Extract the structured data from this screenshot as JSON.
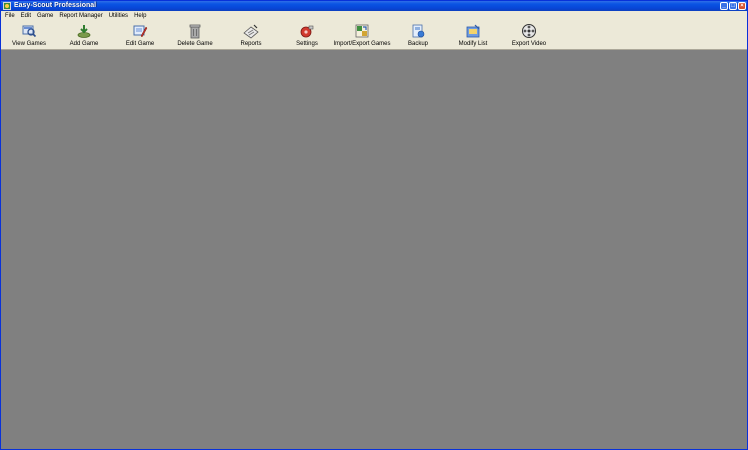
{
  "window": {
    "title": "Easy-Scout Professional",
    "controls": [
      "minimize",
      "maximize",
      "close"
    ]
  },
  "menu": {
    "items": [
      {
        "label": "File"
      },
      {
        "label": "Edit"
      },
      {
        "label": "Game"
      },
      {
        "label": "Report Manager"
      },
      {
        "label": "Utilities"
      },
      {
        "label": "Help"
      }
    ]
  },
  "toolbar": {
    "buttons": [
      {
        "label": "View Games",
        "icon": "view-games-icon"
      },
      {
        "label": "Add Game",
        "icon": "add-game-icon"
      },
      {
        "label": "Edit Game",
        "icon": "edit-game-icon"
      },
      {
        "label": "Delete Game",
        "icon": "trash-can-icon"
      },
      {
        "label": "Reports",
        "icon": "reports-icon"
      },
      {
        "label": "Settings",
        "icon": "settings-icon"
      },
      {
        "label": "Import/Export Games",
        "icon": "import-export-icon"
      },
      {
        "label": "Backup",
        "icon": "backup-icon"
      },
      {
        "label": "Modify List",
        "icon": "modify-list-icon"
      },
      {
        "label": "Export Video",
        "icon": "film-reel-icon"
      }
    ]
  },
  "colors": {
    "title_bar": "#0a54e3",
    "chrome": "#ece9d8",
    "client_area": "#808080"
  }
}
